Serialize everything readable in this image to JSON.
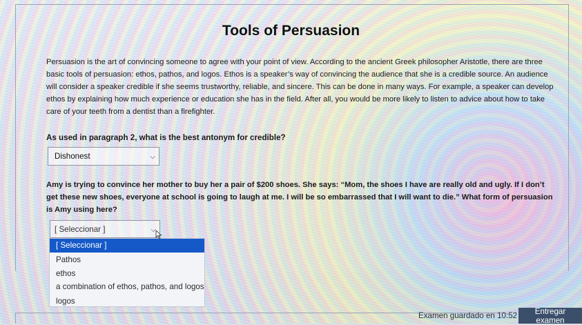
{
  "title": "Tools of Persuasion",
  "passage": "Persuasion is the art of convincing someone to agree with your point of view. According to the ancient Greek philosopher Aristotle, there are three basic tools of persuasion: ethos, pathos, and logos. Ethos is a speaker’s way of convincing the audience that she is a credible source. An audience will consider a speaker credible if she seems trustworthy, reliable, and sincere. This can be done in many ways. For example, a speaker can develop ethos by explaining how much experience or education she has in the field. After all, you would be more likely to listen to advice about how to take care of your teeth from a dentist than a firefighter.",
  "question1": {
    "text": "As used in paragraph 2, what is the best antonym for credible?",
    "selected": "Dishonest"
  },
  "question2": {
    "text": "Amy is trying to convince her mother to buy her a pair of $200 shoes. She says: “Mom, the shoes I have are really old and ugly. If I don’t get these new shoes, everyone at school is going to laugh at me. I will be so embarrassed that I will want to die.” What form of persuasion is Amy using here?",
    "selected": "[ Seleccionar ]",
    "options": [
      "[ Seleccionar ]",
      "Pathos",
      "ethos",
      "a combination of ethos, pathos, and logos",
      "logos"
    ]
  },
  "footer": {
    "status": "Examen guardado en 10:52",
    "submit_label": "Entregar examen"
  },
  "colors": {
    "selected_option": "#1559c9",
    "submit_button": "#3b4f6b"
  }
}
